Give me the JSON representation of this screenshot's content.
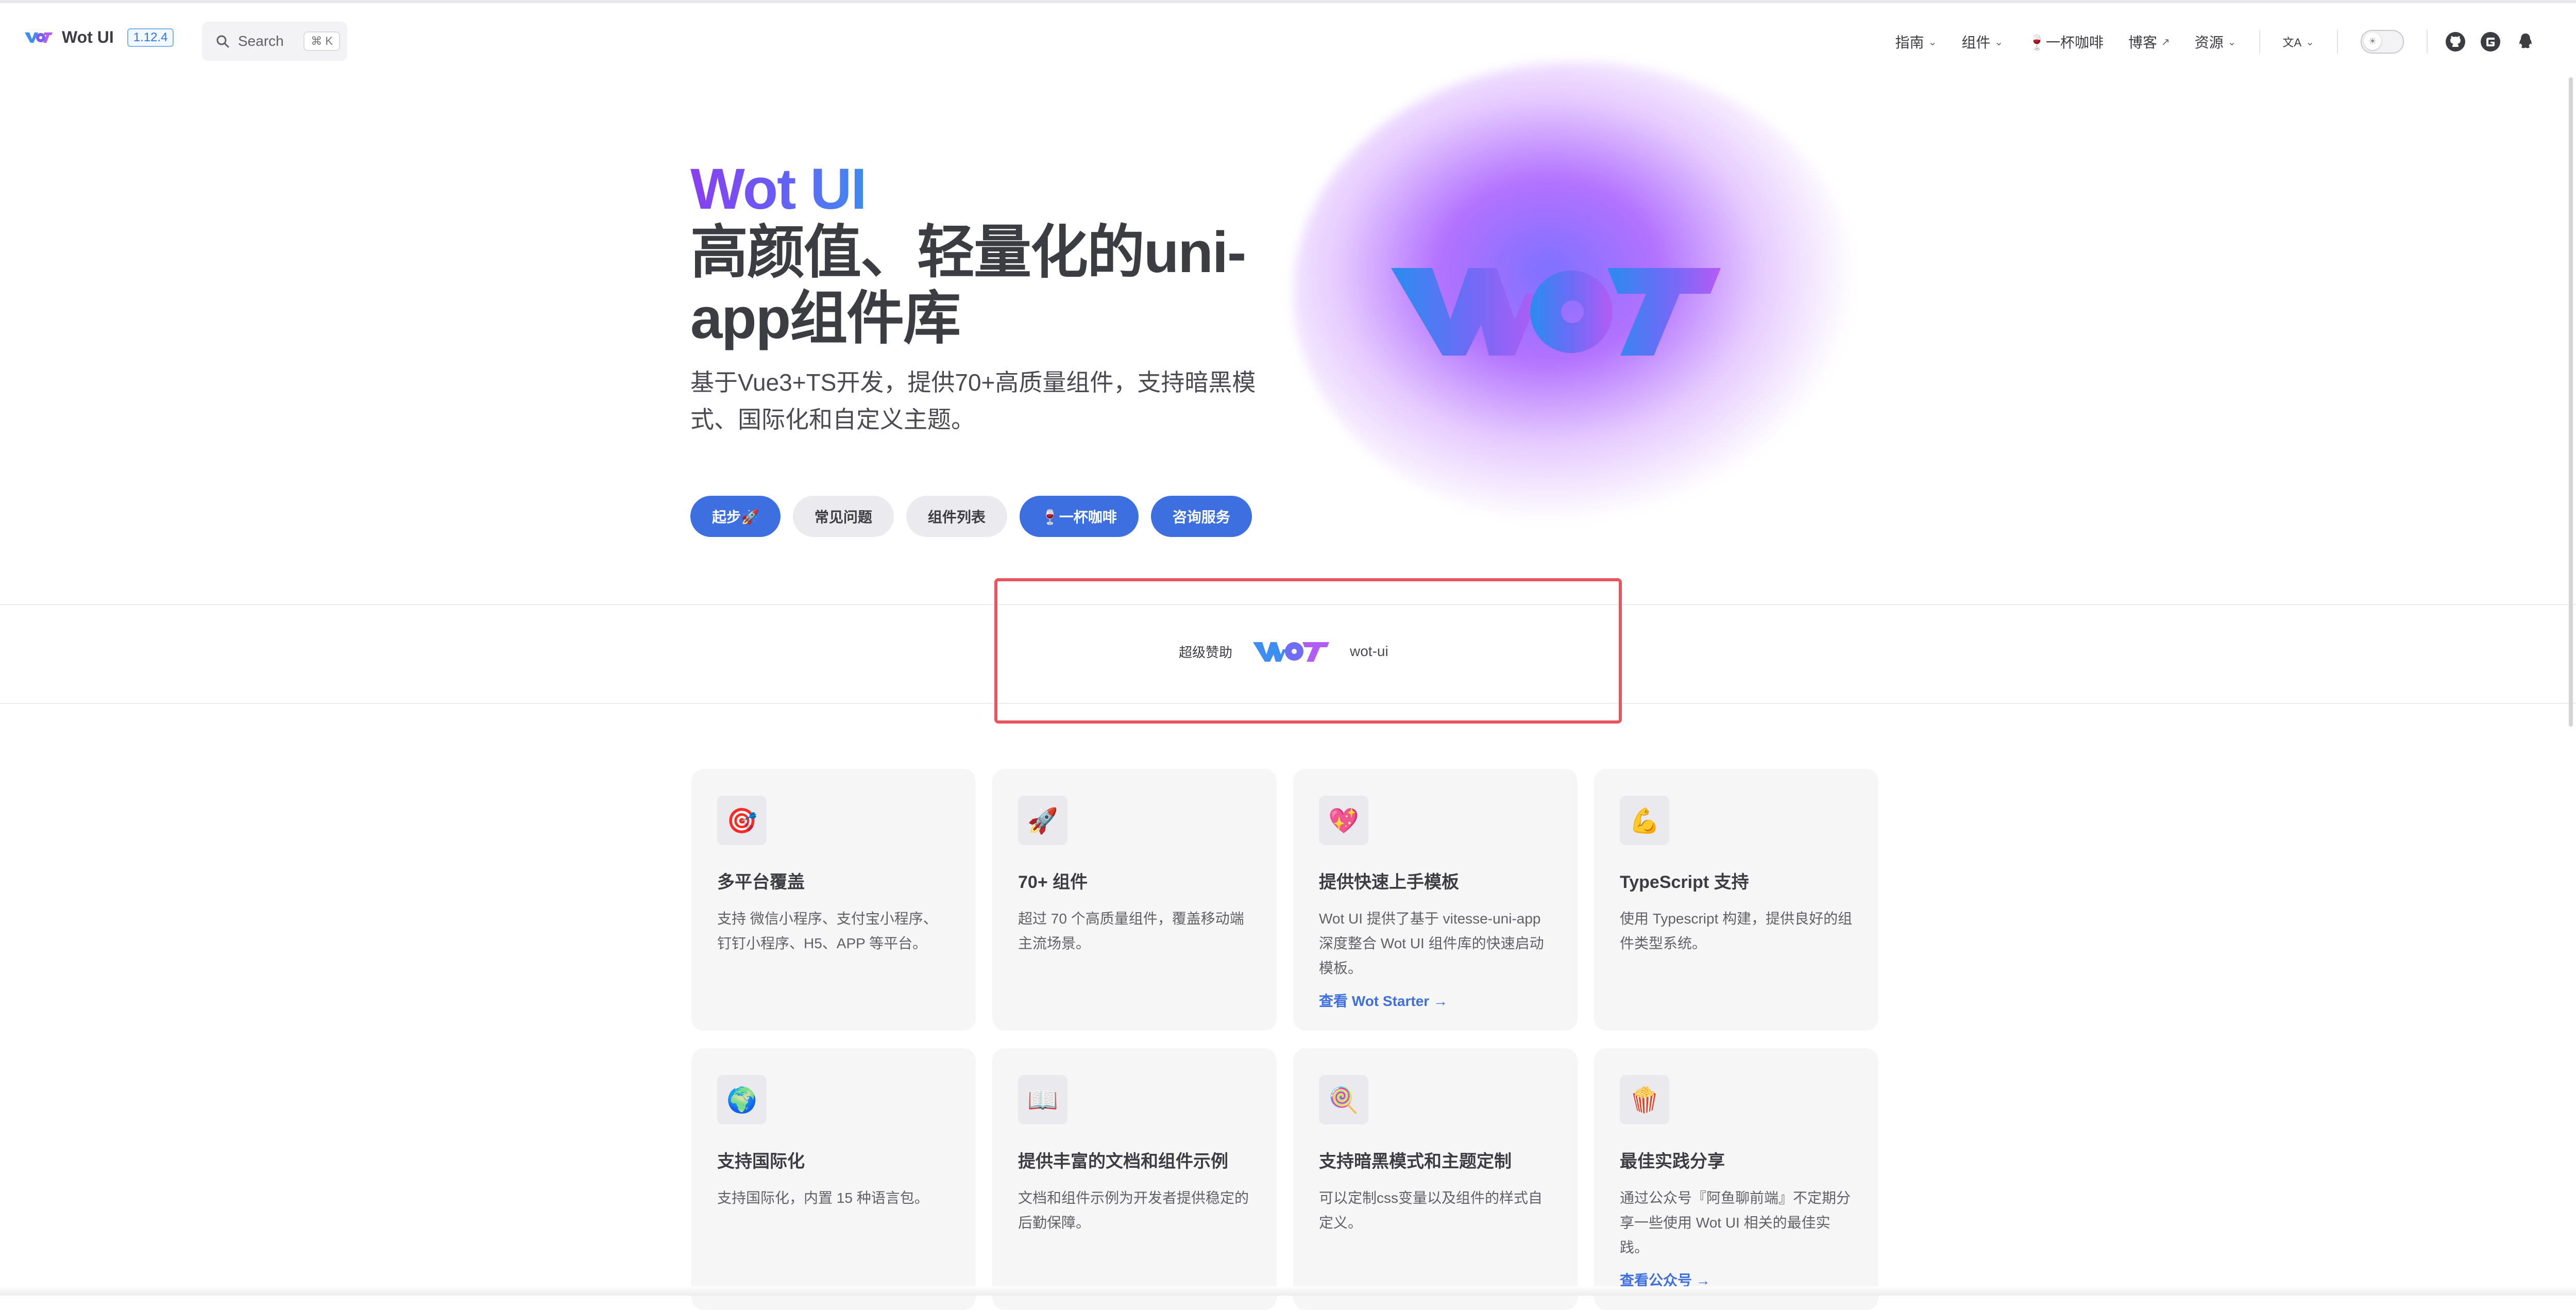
{
  "navbar": {
    "brand_title": "Wot UI",
    "version": "1.12.4",
    "search_placeholder": "Search",
    "search_shortcut": "⌘ K",
    "menu": [
      {
        "label": "指南",
        "caret": "⌄"
      },
      {
        "label": "组件",
        "caret": "⌄"
      },
      {
        "label": "🍷一杯咖啡",
        "caret": ""
      },
      {
        "label": "博客",
        "caret": "↗"
      },
      {
        "label": "资源",
        "caret": "⌄"
      }
    ],
    "language_icon": "文A",
    "language_caret": "⌄",
    "theme_icon": "☀",
    "social": [
      "github-icon",
      "gitee-icon",
      "qq-icon"
    ]
  },
  "hero": {
    "name": "Wot UI",
    "text": "高颜值、轻量化的uni-app组件库",
    "tagline": "基于Vue3+TS开发，提供70+高质量组件，支持暗黑模式、国际化和自定义主题。",
    "actions": [
      {
        "label": "起步🚀",
        "style": "brand"
      },
      {
        "label": "常见问题",
        "style": "alt"
      },
      {
        "label": "组件列表",
        "style": "alt"
      },
      {
        "label": "🍷一杯咖啡",
        "style": "brand"
      },
      {
        "label": "咨询服务",
        "style": "brand"
      }
    ]
  },
  "sponsor": {
    "label": "超级赞助",
    "name": "wot-ui"
  },
  "features": [
    {
      "icon": "🎯",
      "title": "多平台覆盖",
      "desc": "支持 微信小程序、支付宝小程序、钉钉小程序、H5、APP 等平台。",
      "link": ""
    },
    {
      "icon": "🚀",
      "title": "70+ 组件",
      "desc": "超过 70 个高质量组件，覆盖移动端主流场景。",
      "link": ""
    },
    {
      "icon": "💖",
      "title": "提供快速上手模板",
      "desc": "Wot UI 提供了基于 vitesse-uni-app 深度整合 Wot UI 组件库的快速启动模板。",
      "link": "查看 Wot Starter →"
    },
    {
      "icon": "💪",
      "title": "TypeScript 支持",
      "desc": "使用 Typescript 构建，提供良好的组件类型系统。",
      "link": ""
    },
    {
      "icon": "🌍",
      "title": "支持国际化",
      "desc": "支持国际化，内置 15 种语言包。",
      "link": ""
    },
    {
      "icon": "📖",
      "title": "提供丰富的文档和组件示例",
      "desc": "文档和组件示例为开发者提供稳定的后勤保障。",
      "link": ""
    },
    {
      "icon": "🍭",
      "title": "支持暗黑模式和主题定制",
      "desc": "可以定制css变量以及组件的样式自定义。",
      "link": ""
    },
    {
      "icon": "🍿",
      "title": "最佳实践分享",
      "desc": "通过公众号『阿鱼聊前端』不定期分享一些使用 Wot UI 相关的最佳实践。",
      "link": "查看公众号 →"
    }
  ],
  "colors": {
    "brand": "#3d6fe0",
    "highlight_box": "#e8555e",
    "gradient_start": "#8a3ff0",
    "gradient_end": "#3f8bf0"
  }
}
